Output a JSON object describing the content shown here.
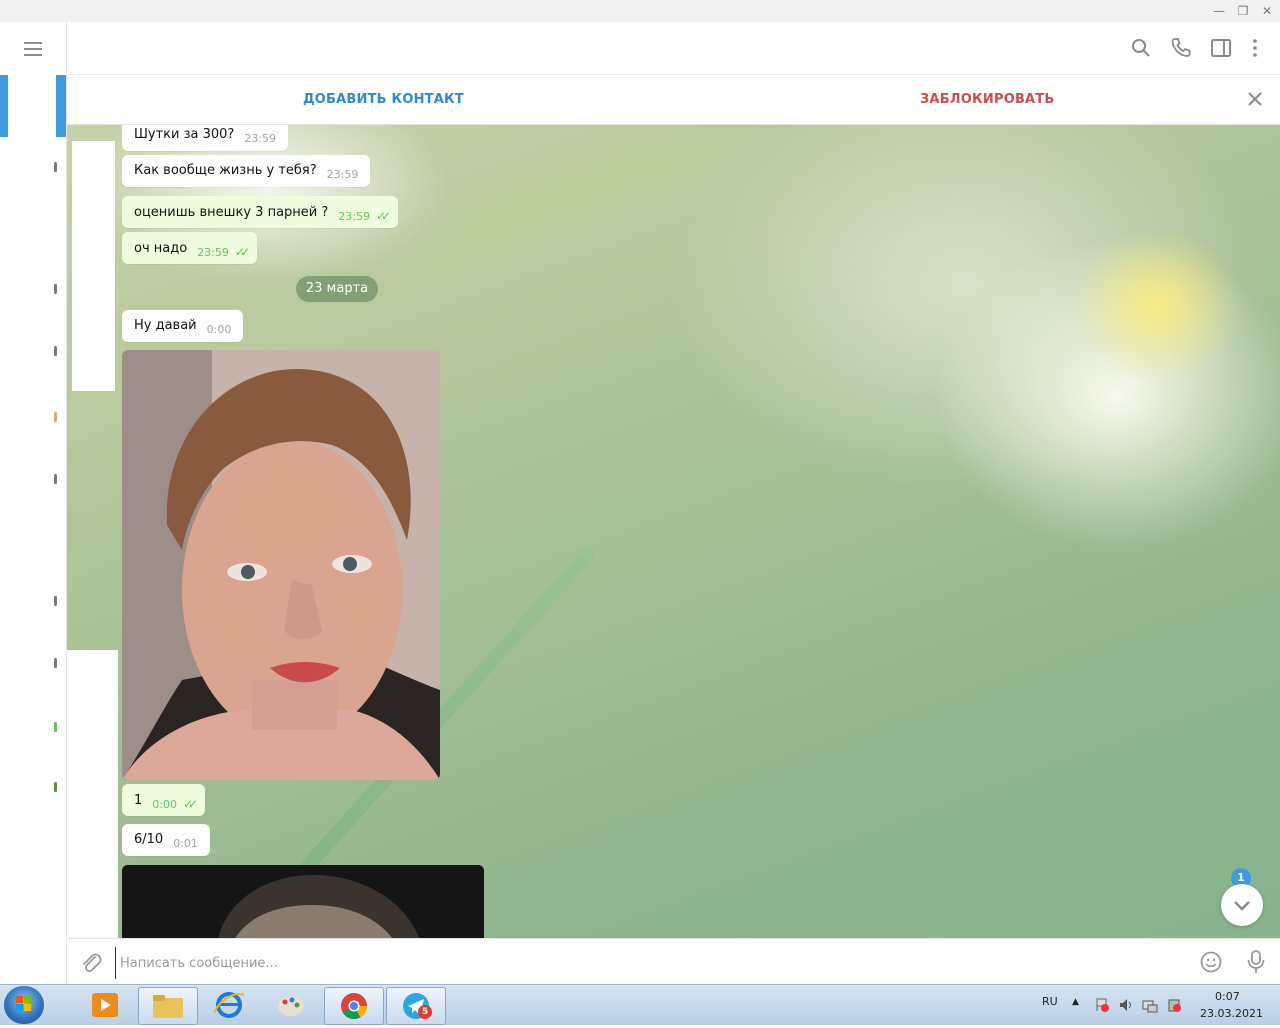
{
  "actions": {
    "add_contact": "ДОБАВИТЬ КОНТАКТ",
    "block": "ЗАБЛОКИРОВАТЬ"
  },
  "messages": [
    {
      "text": "Шутки за 300?",
      "time": "23:59",
      "outgoing": false
    },
    {
      "text": "Как вообще жизнь у тебя?",
      "time": "23:59",
      "outgoing": false
    },
    {
      "text": "оценишь внешку 3 парней ?",
      "time": "23:59",
      "outgoing": true,
      "read": true
    },
    {
      "text": "оч надо",
      "time": "23:59",
      "outgoing": true,
      "read": true
    },
    {
      "text": "Ну давай",
      "time": "0:00",
      "outgoing": false
    },
    {
      "text": "1",
      "time": "0:00",
      "outgoing": true,
      "read": true
    },
    {
      "text": "6/10",
      "time": "0:01",
      "outgoing": false
    }
  ],
  "date_separator": "23 марта",
  "scroll_down": {
    "unread_count": "1"
  },
  "compose": {
    "placeholder": "Написать сообщение..."
  },
  "taskbar": {
    "telegram_badge": "5",
    "language": "RU",
    "time": "0:07",
    "date": "23.03.2021"
  },
  "icons": [
    "menu-icon",
    "search-icon",
    "phone-icon",
    "sidebar-toggle-icon",
    "more-icon",
    "close-icon",
    "attach-icon",
    "emoji-icon",
    "mic-icon",
    "chevron-down-icon"
  ],
  "colors": {
    "accent": "#3e9ae2",
    "danger": "#d14d4d",
    "outgoing_bubble": "#effdde",
    "read_check": "#5fbf54"
  }
}
